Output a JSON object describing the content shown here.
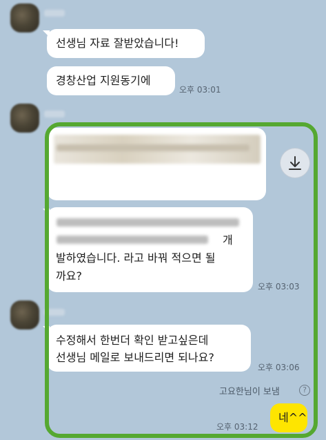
{
  "chat": {
    "messages": {
      "m1": "선생님 자료 잘받았습니다!",
      "m2": "경창산업 지원동기에",
      "m2_time": "오후 03:01",
      "m4_suffix": "개",
      "m4_line2": "발하였습니다. 라고 바꿔 적으면 될",
      "m4_line3": "까요?",
      "m4_time": "오후 03:03",
      "m5_line1": "수정해서 한번더 확인 받고싶은데",
      "m5_line2": "선생님 메일로 보내드리면 되나요?",
      "m5_time": "오후 03:06",
      "sent_by": "고요한님이 보냄",
      "reply": "네^^",
      "reply_time": "오후 03:12"
    },
    "icons": {
      "download": "download-icon",
      "help": "question-circle-icon"
    },
    "colors": {
      "background": "#b2c7d9",
      "bubble_in": "#ffffff",
      "bubble_out": "#fee500",
      "highlight_frame": "#55a831"
    }
  }
}
